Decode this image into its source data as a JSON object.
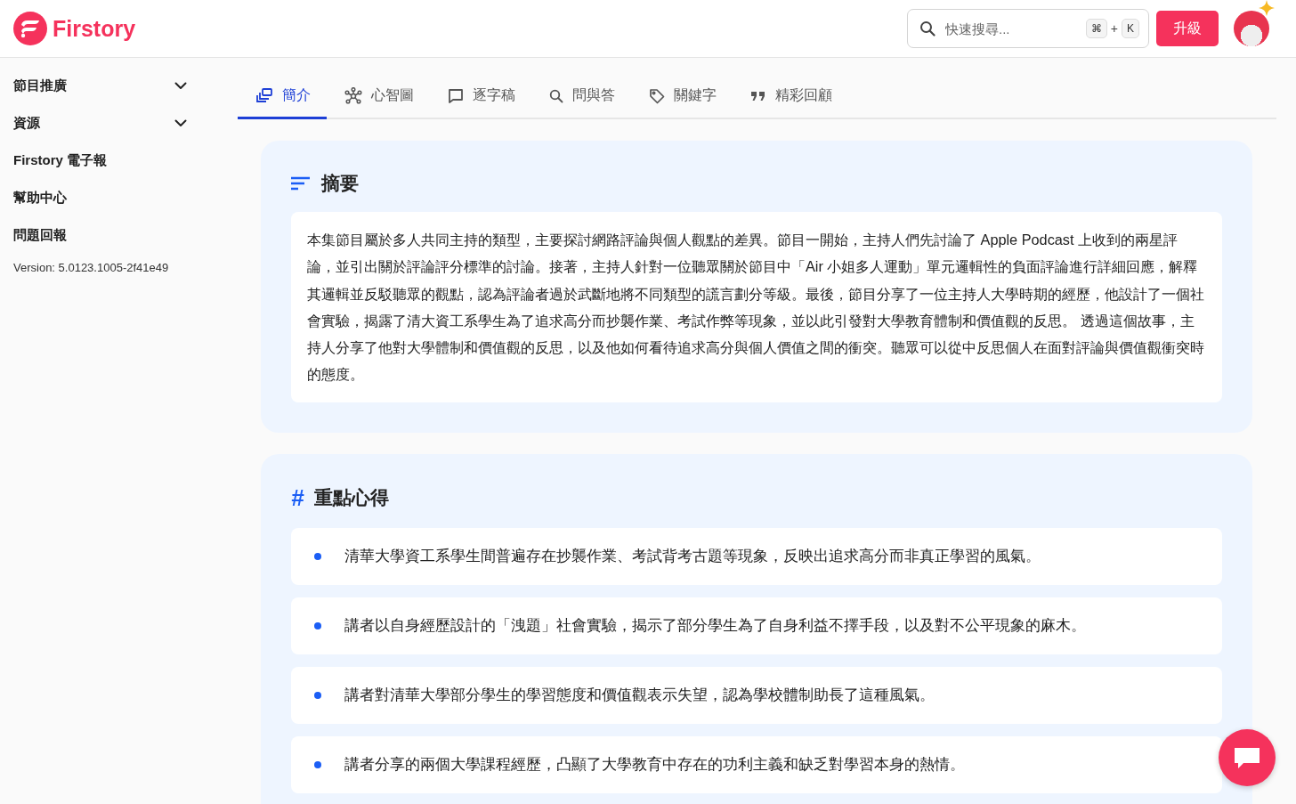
{
  "header": {
    "logo_text": "Firstory",
    "search": {
      "placeholder": "快速搜尋...",
      "shortcut_keys": [
        "⌘",
        "K"
      ],
      "shortcut_joiner": "+"
    },
    "upgrade_button": "升級"
  },
  "sidebar": {
    "items": [
      {
        "label": "節目推廣",
        "kind": "expandable",
        "expanded": false
      },
      {
        "label": "資源",
        "kind": "expandable",
        "expanded": false
      },
      {
        "label": "Firstory 電子報",
        "kind": "link"
      },
      {
        "label": "幫助中心",
        "kind": "link"
      },
      {
        "label": "問題回報",
        "kind": "link"
      }
    ],
    "version": "Version: 5.0123.1005-2f41e49"
  },
  "tabs": [
    {
      "label": "簡介",
      "kind": "intro",
      "selected": true
    },
    {
      "label": "心智圖",
      "kind": "mindmap",
      "selected": false
    },
    {
      "label": "逐字稿",
      "kind": "transcript",
      "selected": false
    },
    {
      "label": "問與答",
      "kind": "qa",
      "selected": false
    },
    {
      "label": "關鍵字",
      "kind": "keyword",
      "selected": false
    },
    {
      "label": "精彩回顧",
      "kind": "quote",
      "selected": false
    }
  ],
  "summary": {
    "title": "摘要",
    "text": "本集節目屬於多人共同主持的類型，主要探討網路評論與個人觀點的差異。節目一開始，主持人們先討論了 Apple Podcast 上收到的兩星評論，並引出關於評論評分標準的討論。接著，主持人針對一位聽眾關於節目中「Air 小姐多人運動」單元邏輯性的負面評論進行詳細回應，解釋其邏輯並反駁聽眾的觀點，認為評論者過於武斷地將不同類型的謊言劃分等級。最後，節目分享了一位主持人大學時期的經歷，他設計了一個社會實驗，揭露了清大資工系學生為了追求高分而抄襲作業、考試作弊等現象，並以此引發對大學教育體制和價值觀的反思。 透過這個故事，主持人分享了他對大學體制和價值觀的反思，以及他如何看待追求高分與個人價值之間的衝突。聽眾可以從中反思個人在面對評論與價值觀衝突時的態度。"
  },
  "highlights": {
    "title": "重點心得",
    "title_icon": "#",
    "items": [
      "清華大學資工系學生間普遍存在抄襲作業、考試背考古題等現象，反映出追求高分而非真正學習的風氣。",
      "講者以自身經歷設計的「洩題」社會實驗，揭示了部分學生為了自身利益不擇手段，以及對不公平現象的麻木。",
      "講者對清華大學部分學生的學習態度和價值觀表示失望，認為學校體制助長了這種風氣。",
      "講者分享的兩個大學課程經歷，凸顯了大學教育中存在的功利主義和缺乏對學習本身的熱情。"
    ]
  }
}
